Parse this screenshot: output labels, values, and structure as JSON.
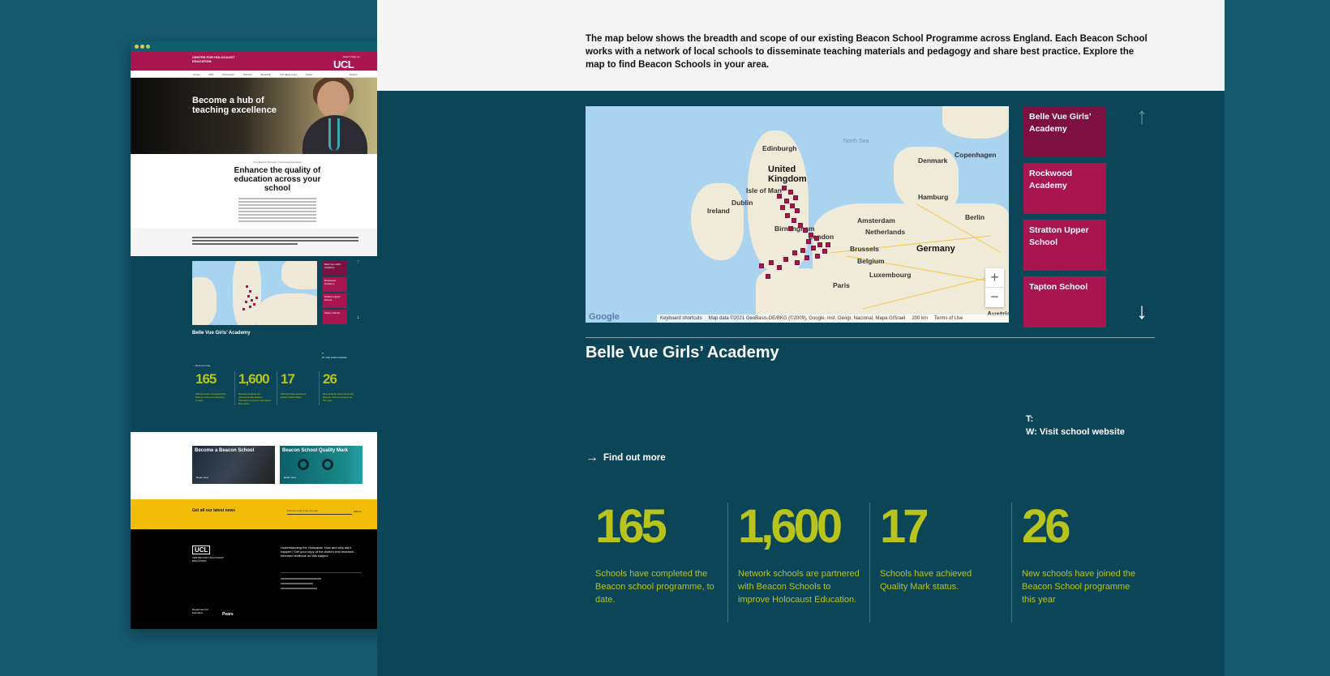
{
  "mini": {
    "brand": "CENTRE FOR HOLOCAUST EDUCATION",
    "logo": "UCL",
    "topnav": "Search  Sign up",
    "nav": [
      "Home",
      "CPD",
      "Resources",
      "Schools",
      "Research",
      "Our latest news",
      "About"
    ],
    "nav_search": "Search",
    "hero_title": "Become a hub of teaching excellence",
    "crumb": "UCL Beacon Schools in Holocaust Education",
    "intro_title": "Enhance the quality of education across your school",
    "cards": [
      "Belle Vue Girls' Academy",
      "Rockwood Academy",
      "Stratton Upper School",
      "Tapton School"
    ],
    "school": "Belle Vue Girls’ Academy",
    "web": "T:\nW: Visit school website",
    "find": "Find out more",
    "promo": [
      {
        "title": "Become a Beacon School",
        "link": "Read more"
      },
      {
        "title": "Beacon School Quality Mark",
        "link": "Read more"
      }
    ],
    "news_label": "Get all our latest news",
    "news_placeholder": "Enter your email to stay up to date",
    "news_submit": "Submit",
    "footer_logo": "UCL",
    "footer_sub": "CENTRE FOR HOLOCAUST EDUCATION",
    "footer_text": "Understanding the Holocaust. How and why did it happen? Get your copy of the world's first research-informed textbook on this subject.",
    "footer_dfe": "Department for Education",
    "footer_pears": "Pears"
  },
  "panel": {
    "intro": "The map below shows the breadth and scope of our existing Beacon School Programme across England. Each Beacon School works with a network of local schools to disseminate teaching materials and pedagogy and share best practice. Explore the map to find Beacon Schools in your area.",
    "map": {
      "labels": {
        "north_sea": "North Sea",
        "edinburgh": "Edinburgh",
        "uk": "United Kingdom",
        "isle_of_man": "Isle of Man",
        "dublin": "Dublin",
        "ireland": "Ireland",
        "birmingham": "Birmingham",
        "london": "London",
        "denmark": "Denmark",
        "copenhagen": "Copenhagen",
        "hamburg": "Hamburg",
        "amsterdam": "Amsterdam",
        "netherlands": "Netherlands",
        "berlin": "Berlin",
        "germany": "Germany",
        "brussels": "Brussels",
        "belgium": "Belgium",
        "luxembourg": "Luxembourg",
        "paris": "Paris",
        "austria": "Austria"
      },
      "zoom_in": "+",
      "zoom_out": "−",
      "google": "Google",
      "attribution": [
        "Keyboard shortcuts",
        "Map data ©2021 GeoBasis-DE/BKG (©2009), Google, Inst. Geogr. Nacional, Mapa GISrael",
        "200 km",
        "Terms of Use"
      ]
    },
    "cards": [
      {
        "label": "Belle Vue Girls’ Academy"
      },
      {
        "label": "Rockwood Academy"
      },
      {
        "label": "Stratton Upper School"
      },
      {
        "label": "Tapton School"
      }
    ],
    "arrow_up": "↑",
    "arrow_down": "↓",
    "school_name": "Belle Vue Girls’ Academy",
    "contact_t": "T:",
    "contact_w": "W: Visit school website",
    "find_more": "Find out more",
    "find_arrow": "→",
    "stats": [
      {
        "number": "165",
        "text": "Schools have completed the Beacon school programme, to date."
      },
      {
        "number": "1,600",
        "text": "Network schools are partnered with Beacon Schools to improve Holocaust Education."
      },
      {
        "number": "17",
        "text": "Schools have achieved Quality Mark status."
      },
      {
        "number": "26",
        "text": "New schools have joined the Beacon School programme this year"
      }
    ]
  },
  "colors": {
    "background": "#175a6e",
    "panel": "#0c4557",
    "magenta": "#a8154f",
    "magenta_active": "#7c1040",
    "stat_green": "#b8c41c",
    "news_yellow": "#f1bd07"
  }
}
